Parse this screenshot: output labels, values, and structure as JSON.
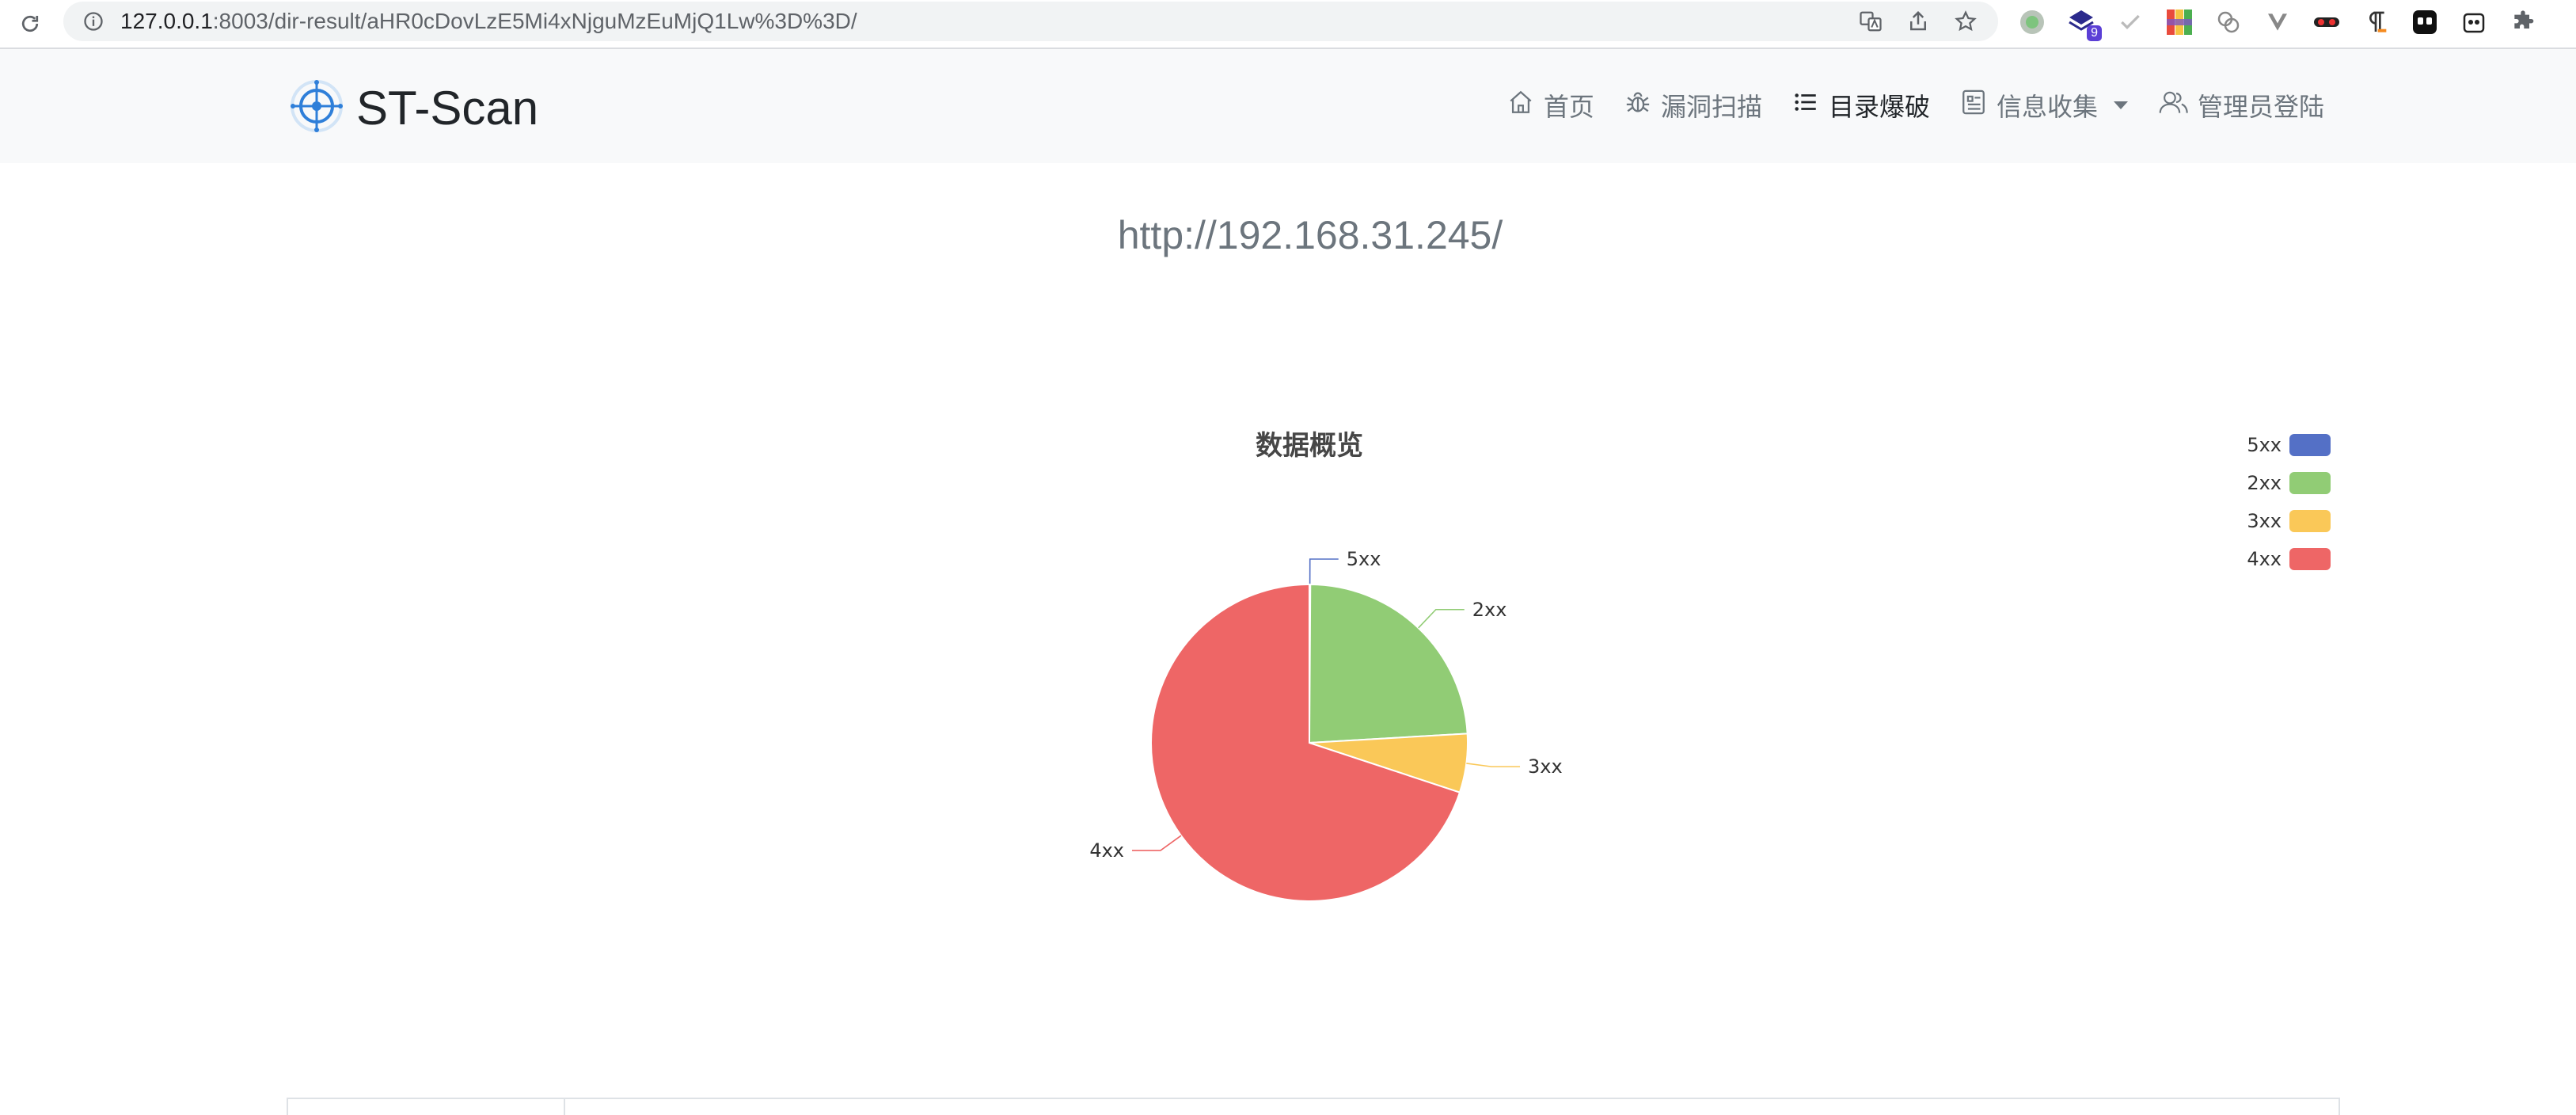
{
  "browser": {
    "url_host": "127.0.0.1",
    "url_rest": ":8003/dir-result/aHR0cDovLzE5Mi4xNjguMzEuMjQ1Lw%3D%3D/",
    "extension_badge": "9",
    "icons": [
      "reload-icon",
      "site-info-icon",
      "translate-icon",
      "share-icon",
      "bookmark-star-icon",
      "extensions-puzzle-icon"
    ]
  },
  "navbar": {
    "brand": "ST-Scan",
    "items": [
      {
        "label": "首页",
        "icon": "home-icon"
      },
      {
        "label": "漏洞扫描",
        "icon": "bug-icon"
      },
      {
        "label": "目录爆破",
        "icon": "list-icon",
        "active": true
      },
      {
        "label": "信息收集",
        "icon": "card-icon",
        "dropdown": true
      },
      {
        "label": "管理员登陆",
        "icon": "users-icon"
      }
    ]
  },
  "main": {
    "target_url": "http://192.168.31.245/"
  },
  "chart_data": {
    "type": "pie",
    "title": "数据概览",
    "legend_position": "top-right",
    "labels": [
      "5xx",
      "2xx",
      "3xx",
      "4xx"
    ],
    "values": [
      0.1,
      24,
      6,
      70
    ],
    "colors": [
      "#5470c6",
      "#91cc75",
      "#fac858",
      "#ee6666"
    ]
  }
}
